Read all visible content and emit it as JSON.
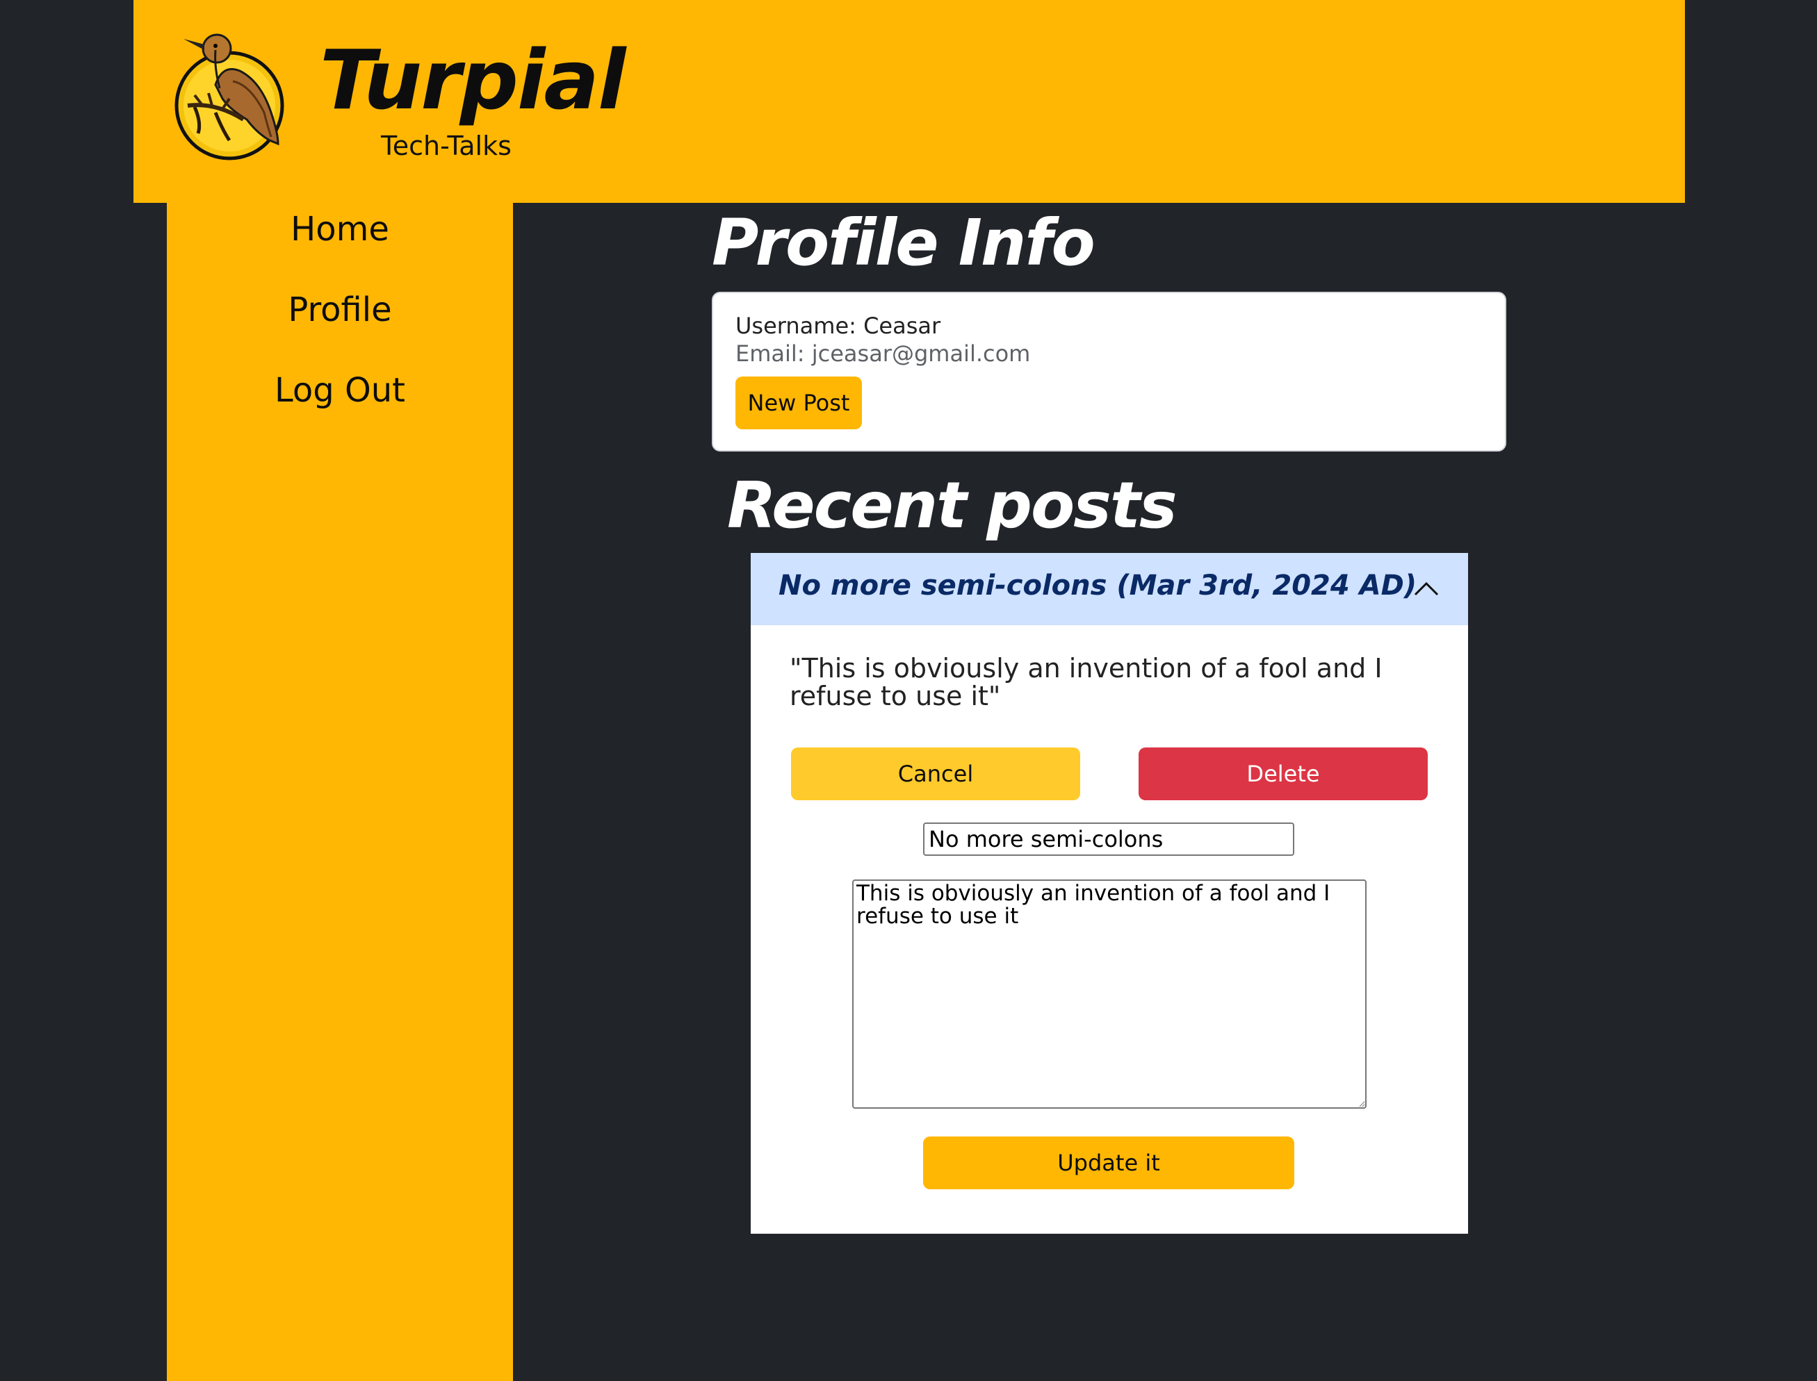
{
  "brand": {
    "title": "Turpial",
    "subtitle": "Tech-Talks"
  },
  "nav": {
    "items": [
      {
        "label": "Home"
      },
      {
        "label": "Profile"
      },
      {
        "label": "Log Out"
      }
    ]
  },
  "profile": {
    "heading": "Profile Info",
    "username": "Username: Ceasar",
    "email": "Email: jceasar@gmail.com",
    "new_post_label": "New Post"
  },
  "posts": {
    "heading": "Recent posts",
    "items": [
      {
        "header": "No more semi-colons (Mar 3rd, 2024 AD)",
        "quote": "\"This is obviously an invention of a fool and I refuse to use it\"",
        "cancel_label": "Cancel",
        "delete_label": "Delete",
        "title_value": "No more semi-colons",
        "body_value": "This is obviously an invention of a fool and I refuse to use it",
        "update_label": "Update it"
      }
    ]
  },
  "colors": {
    "brand_yellow": "#ffb703",
    "background": "#212429",
    "cancel_yellow": "#ffca2c",
    "delete_red": "#dc3545",
    "accordion_header": "#cfe2ff"
  },
  "icons": {
    "logo": "turpial-bird-logo",
    "toggle": "chevron-up-icon"
  }
}
